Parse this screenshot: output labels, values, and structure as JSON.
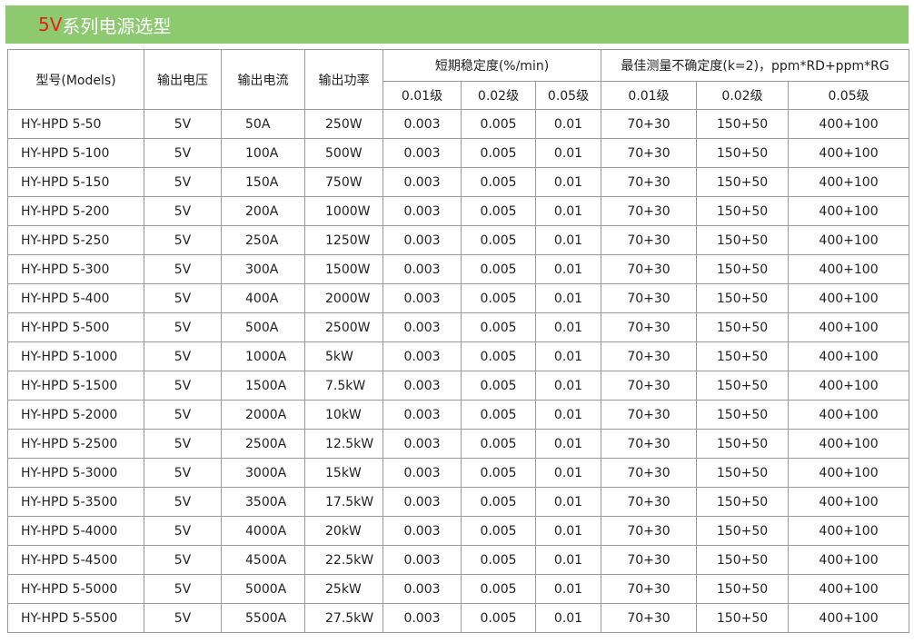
{
  "title": {
    "accent": "5V",
    "rest": "系列电源选型"
  },
  "headers": {
    "model": "型号(Models)",
    "voltage": "输出电压",
    "current": "输出电流",
    "power": "输出功率",
    "stability": "短期稳定度(%/min)",
    "uncertainty": "最佳测量不确定度(k=2)，ppm*RD+ppm*RG",
    "grades": [
      "0.01级",
      "0.02级",
      "0.05级",
      "0.01级",
      "0.02级",
      "0.05级"
    ]
  },
  "rows": [
    [
      "HY-HPD 5-50",
      "5V",
      "50A",
      "250W",
      "0.003",
      "0.005",
      "0.01",
      "70+30",
      "150+50",
      "400+100"
    ],
    [
      "HY-HPD 5-100",
      "5V",
      "100A",
      "500W",
      "0.003",
      "0.005",
      "0.01",
      "70+30",
      "150+50",
      "400+100"
    ],
    [
      "HY-HPD 5-150",
      "5V",
      "150A",
      "750W",
      "0.003",
      "0.005",
      "0.01",
      "70+30",
      "150+50",
      "400+100"
    ],
    [
      "HY-HPD 5-200",
      "5V",
      "200A",
      "1000W",
      "0.003",
      "0.005",
      "0.01",
      "70+30",
      "150+50",
      "400+100"
    ],
    [
      "HY-HPD 5-250",
      "5V",
      "250A",
      "1250W",
      "0.003",
      "0.005",
      "0.01",
      "70+30",
      "150+50",
      "400+100"
    ],
    [
      "HY-HPD 5-300",
      "5V",
      "300A",
      "1500W",
      "0.003",
      "0.005",
      "0.01",
      "70+30",
      "150+50",
      "400+100"
    ],
    [
      "HY-HPD 5-400",
      "5V",
      "400A",
      "2000W",
      "0.003",
      "0.005",
      "0.01",
      "70+30",
      "150+50",
      "400+100"
    ],
    [
      "HY-HPD 5-500",
      "5V",
      "500A",
      "2500W",
      "0.003",
      "0.005",
      "0.01",
      "70+30",
      "150+50",
      "400+100"
    ],
    [
      "HY-HPD 5-1000",
      "5V",
      "1000A",
      "5kW",
      "0.003",
      "0.005",
      "0.01",
      "70+30",
      "150+50",
      "400+100"
    ],
    [
      "HY-HPD 5-1500",
      "5V",
      "1500A",
      "7.5kW",
      "0.003",
      "0.005",
      "0.01",
      "70+30",
      "150+50",
      "400+100"
    ],
    [
      "HY-HPD 5-2000",
      "5V",
      "2000A",
      "10kW",
      "0.003",
      "0.005",
      "0.01",
      "70+30",
      "150+50",
      "400+100"
    ],
    [
      "HY-HPD 5-2500",
      "5V",
      "2500A",
      "12.5kW",
      "0.003",
      "0.005",
      "0.01",
      "70+30",
      "150+50",
      "400+100"
    ],
    [
      "HY-HPD 5-3000",
      "5V",
      "3000A",
      "15kW",
      "0.003",
      "0.005",
      "0.01",
      "70+30",
      "150+50",
      "400+100"
    ],
    [
      "HY-HPD 5-3500",
      "5V",
      "3500A",
      "17.5kW",
      "0.003",
      "0.005",
      "0.01",
      "70+30",
      "150+50",
      "400+100"
    ],
    [
      "HY-HPD 5-4000",
      "5V",
      "4000A",
      "20kW",
      "0.003",
      "0.005",
      "0.01",
      "70+30",
      "150+50",
      "400+100"
    ],
    [
      "HY-HPD 5-4500",
      "5V",
      "4500A",
      "22.5kW",
      "0.003",
      "0.005",
      "0.01",
      "70+30",
      "150+50",
      "400+100"
    ],
    [
      "HY-HPD 5-5000",
      "5V",
      "5000A",
      "25kW",
      "0.003",
      "0.005",
      "0.01",
      "70+30",
      "150+50",
      "400+100"
    ],
    [
      "HY-HPD 5-5500",
      "5V",
      "5500A",
      "27.5kW",
      "0.003",
      "0.005",
      "0.01",
      "70+30",
      "150+50",
      "400+100"
    ]
  ],
  "colors": {
    "title_bg": "#8dc96f",
    "title_accent": "#e8201a",
    "border": "#9a9a9a"
  }
}
